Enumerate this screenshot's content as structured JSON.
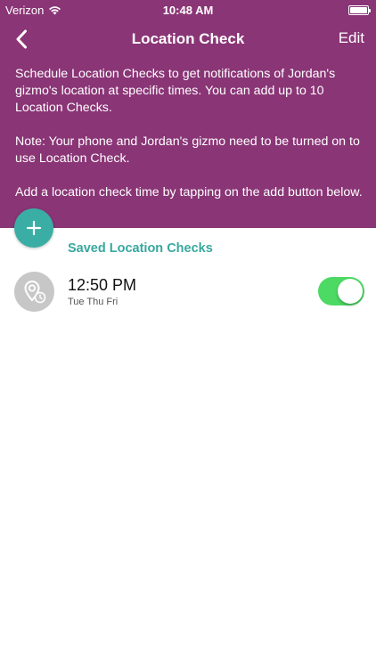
{
  "status_bar": {
    "carrier": "Verizon",
    "time": "10:48 AM"
  },
  "nav": {
    "title": "Location Check",
    "edit_label": "Edit",
    "back_icon": "chevron-left-icon"
  },
  "intro": {
    "paragraphs": [
      "Schedule Location Checks to get notifications of Jordan's gizmo's location at specific times. You can add up to 10 Location Checks.",
      "Note: Your phone and Jordan's gizmo need to be turned on to use Location Check.",
      "Add a location check time by tapping on the add button below."
    ]
  },
  "add_button": {
    "icon": "plus-icon"
  },
  "saved": {
    "section_title": "Saved Location Checks",
    "items": [
      {
        "time": "12:50 PM",
        "days": "Tue Thu Fri",
        "enabled": true
      }
    ]
  },
  "colors": {
    "header_bg": "#8a3576",
    "accent": "#3aaea5",
    "toggle_on": "#4cd964"
  }
}
